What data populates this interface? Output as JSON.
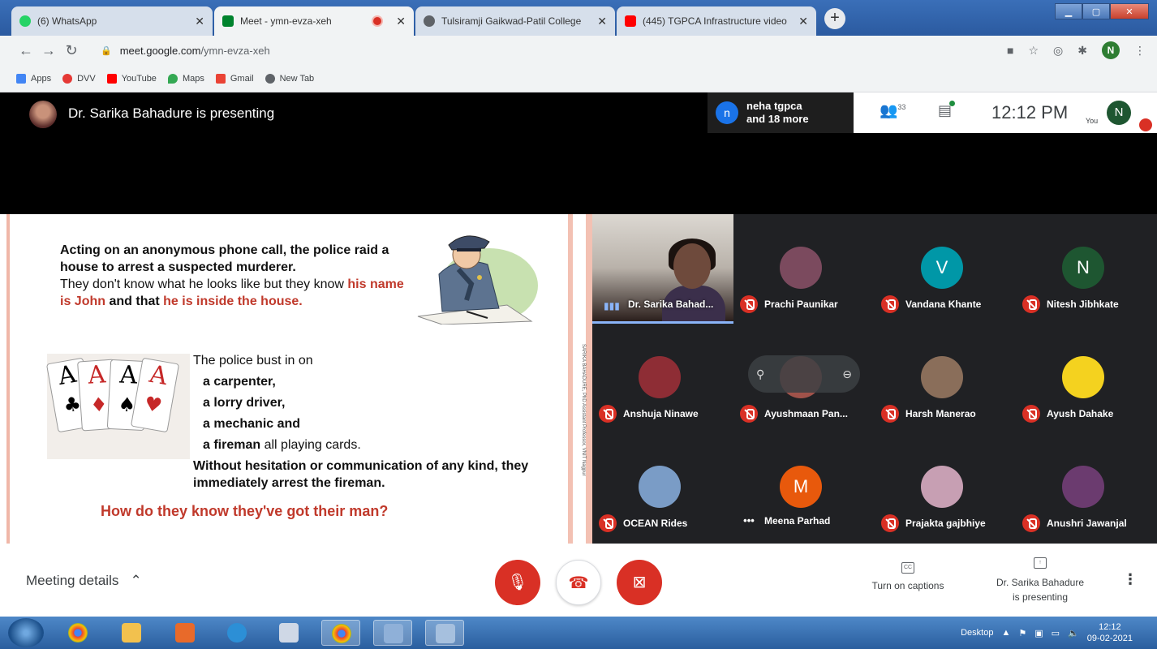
{
  "browser": {
    "tabs": [
      {
        "title": "(6) WhatsApp",
        "favicon_color": "#25d366",
        "active": false
      },
      {
        "title": "Meet - ymn-evza-xeh",
        "favicon_color": "#00832d",
        "active": true
      },
      {
        "title": "Tulsiramji Gaikwad-Patil College",
        "favicon_color": "#5f6368",
        "active": false
      },
      {
        "title": "(445) TGPCA Infrastructure video",
        "favicon_color": "#ff0000",
        "active": false
      }
    ],
    "new_tab_label": "+",
    "url_domain": "meet.google.com",
    "url_path": "/ymn-evza-xeh",
    "profile_initial": "N",
    "bookmarks": [
      {
        "label": "Apps",
        "color": "#4285f4"
      },
      {
        "label": "DVV",
        "color": "#e53935"
      },
      {
        "label": "YouTube",
        "color": "#ff0000"
      },
      {
        "label": "Maps",
        "color": "#34a853"
      },
      {
        "label": "Gmail",
        "color": "#ea4335"
      },
      {
        "label": "New Tab",
        "color": "#5f6368"
      }
    ]
  },
  "meet": {
    "presenting_text": "Dr. Sarika Bahadure is presenting",
    "join_notice": {
      "initial": "n",
      "line1": "neha tgpca",
      "line2": "and 18 more"
    },
    "people_count": "33",
    "clock": "12:12 PM",
    "you_label": "You",
    "you_initial": "N",
    "accent": "#1a73e8",
    "mute_color": "#d93025"
  },
  "slide": {
    "para1_bold": "Acting on an anonymous phone call, the police raid a house to arrest a suspected murderer.",
    "para1_normal": "They don't know what he looks like but they know",
    "para1_red1": "his name is John",
    "para1_and": "and that",
    "para1_red2": "he is inside the house.",
    "bust_in": "The police bust in on",
    "list": [
      "a carpenter,",
      "a lorry driver,",
      "a mechanic and"
    ],
    "fireman_bold": "a fireman",
    "fireman_rest": "all playing cards.",
    "conclusion": "Without hesitation or communication of any kind, they immediately arrest the fireman.",
    "question": "How do they know they've got their man?",
    "side_watermark": "SARIKA BAHADURE, PhD  Assistant Professor, VNIT Nagpur",
    "cards": [
      "A",
      "A",
      "A",
      "A"
    ]
  },
  "participants": [
    {
      "name": "Dr. Sarika Bahad...",
      "type": "video"
    },
    {
      "name": "Prachi Paunikar",
      "type": "photo",
      "color": "#7b4a5e"
    },
    {
      "name": "Vandana Khante",
      "type": "initial",
      "initial": "V",
      "color": "#0097a7"
    },
    {
      "name": "Nitesh Jibhkate",
      "type": "initial",
      "initial": "N",
      "color": "#1e5631"
    },
    {
      "name": "Anshuja Ninawe",
      "type": "photo",
      "color": "#8e2d35"
    },
    {
      "name": "Ayushmaan Pan...",
      "type": "photo",
      "color": "#a0524a"
    },
    {
      "name": "Harsh Manerao",
      "type": "photo",
      "color": "#8a6e5a"
    },
    {
      "name": "Ayush Dahake",
      "type": "photo",
      "color": "#f4d21f"
    },
    {
      "name": "OCEAN Rides",
      "type": "photo",
      "color": "#7a9cc6"
    },
    {
      "name": "Meena Parhad",
      "type": "initial",
      "initial": "M",
      "color": "#e8590c",
      "speaking": true
    },
    {
      "name": "Prajakta gajbhiye",
      "type": "photo",
      "color": "#c79fb3"
    },
    {
      "name": "Anushri Jawanjal",
      "type": "photo",
      "color": "#6b3b6f"
    }
  ],
  "bottom": {
    "meeting_details": "Meeting details",
    "captions_label": "Turn on captions",
    "captions_icon": "CC",
    "presenting_line1": "Dr. Sarika Bahadure",
    "presenting_line2": "is presenting"
  },
  "taskbar": {
    "desktop_label": "Desktop",
    "time": "12:12",
    "date": "09-02-2021"
  }
}
